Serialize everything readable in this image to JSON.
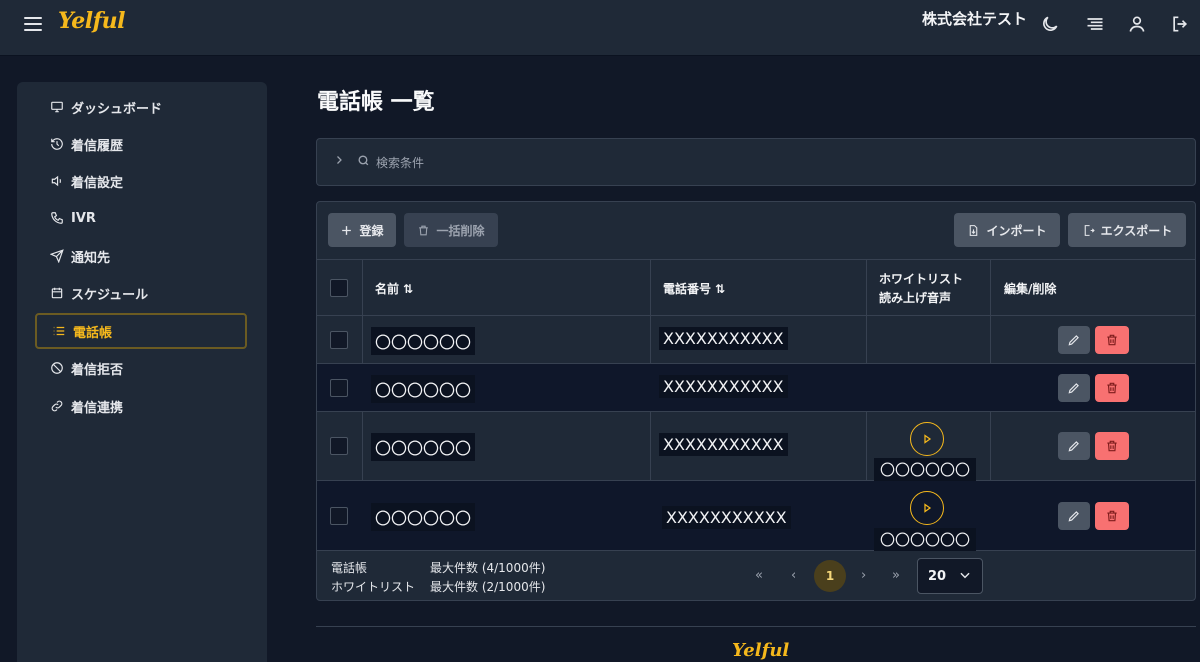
{
  "header": {
    "logo_text": "Yelful",
    "company_name": "株式会社テスト",
    "icons": [
      "menu-icon",
      "moon-icon",
      "list-icon",
      "user-icon",
      "logout-icon"
    ]
  },
  "sidebar": {
    "items": [
      {
        "label": "ダッシュボード",
        "icon": "monitor-icon"
      },
      {
        "label": "着信履歴",
        "icon": "history-icon"
      },
      {
        "label": "着信設定",
        "icon": "speaker-icon"
      },
      {
        "label": "IVR",
        "icon": "phone-icon"
      },
      {
        "label": "通知先",
        "icon": "send-icon"
      },
      {
        "label": "スケジュール",
        "icon": "calendar-icon"
      },
      {
        "label": "電話帳",
        "icon": "list-icon",
        "active": true
      },
      {
        "label": "着信拒否",
        "icon": "ban-icon"
      },
      {
        "label": "着信連携",
        "icon": "link-icon"
      }
    ]
  },
  "main": {
    "title": "電話帳 一覧",
    "search_label": "検索条件",
    "toolbar": {
      "register": "登録",
      "bulk_delete": "一括削除",
      "import": "インポート",
      "export": "エクスポート"
    },
    "table": {
      "columns": {
        "name": "名前 ⇅",
        "phone": "電話番号 ⇅",
        "whitelist_line1": "ホワイトリスト",
        "whitelist_line2": "読み上げ音声",
        "actions": "編集/削除"
      },
      "rows": [
        {
          "name": "〇〇〇〇〇〇",
          "phone": "XXXXXXXXXXX",
          "voice": ""
        },
        {
          "name": "〇〇〇〇〇〇",
          "phone": "XXXXXXXXXXX",
          "voice": ""
        },
        {
          "name": "〇〇〇〇〇〇",
          "phone": "XXXXXXXXXXX",
          "voice": "〇〇〇〇〇〇"
        },
        {
          "name": "〇〇〇〇〇〇",
          "phone": "XXXXXXXXXXX",
          "voice": "〇〇〇〇〇〇"
        }
      ]
    },
    "footer": {
      "phonebook_label": "電話帳",
      "phonebook_count": "最大件数 (4/1000件)",
      "whitelist_label": "ホワイトリスト",
      "whitelist_count": "最大件数 (2/1000件)"
    },
    "pagination": {
      "first": "«",
      "prev": "‹",
      "current": "1",
      "next": "›",
      "last": "»",
      "page_size": "20"
    }
  },
  "colors": {
    "accent": "#f5b81c",
    "danger": "#f87171",
    "background": "#111827",
    "panel": "#1f2937"
  }
}
